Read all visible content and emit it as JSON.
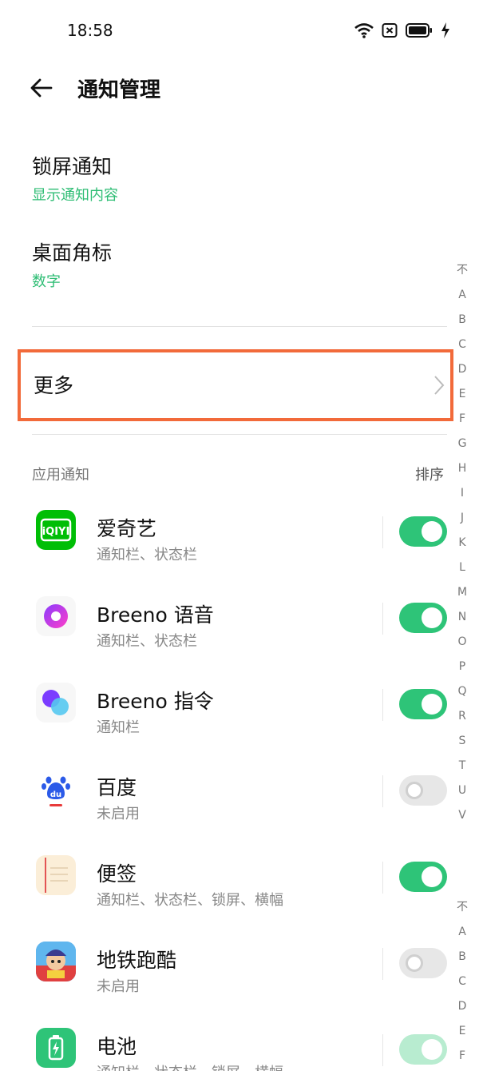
{
  "status_bar": {
    "time": "18:58"
  },
  "header": {
    "title": "通知管理"
  },
  "lock_screen": {
    "title": "锁屏通知",
    "value": "显示通知内容"
  },
  "badge": {
    "title": "桌面角标",
    "value": "数字"
  },
  "more": {
    "label": "更多"
  },
  "apps_section": {
    "title": "应用通知",
    "sort_label": "排序"
  },
  "apps": [
    {
      "name": "爱奇艺",
      "desc": "通知栏、状态栏",
      "enabled": true,
      "icon": "iqiyi-icon"
    },
    {
      "name": "Breeno 语音",
      "desc": "通知栏、状态栏",
      "enabled": true,
      "icon": "breeno-voice-icon"
    },
    {
      "name": "Breeno 指令",
      "desc": "通知栏",
      "enabled": true,
      "icon": "breeno-command-icon"
    },
    {
      "name": "百度",
      "desc": "未启用",
      "enabled": false,
      "icon": "baidu-icon"
    },
    {
      "name": "便签",
      "desc": "通知栏、状态栏、锁屏、横幅",
      "enabled": true,
      "icon": "notes-icon"
    },
    {
      "name": "地铁跑酷",
      "desc": "未启用",
      "enabled": false,
      "icon": "subway-surfers-icon"
    },
    {
      "name": "电池",
      "desc": "通知栏、状态栏、锁屏、横幅",
      "enabled": true,
      "icon": "battery-app-icon"
    }
  ],
  "alpha_index_1": [
    "不",
    "A",
    "B",
    "C",
    "D",
    "E",
    "F",
    "G",
    "H",
    "I",
    "J",
    "K",
    "L",
    "M",
    "N",
    "O",
    "P",
    "Q",
    "R",
    "S",
    "T",
    "U",
    "V"
  ],
  "alpha_index_2": [
    "不",
    "A",
    "B",
    "C",
    "D",
    "E",
    "F"
  ],
  "colors": {
    "accent": "#2ebd74",
    "highlight": "#f26a3a",
    "toggle_on": "#2ec478"
  }
}
